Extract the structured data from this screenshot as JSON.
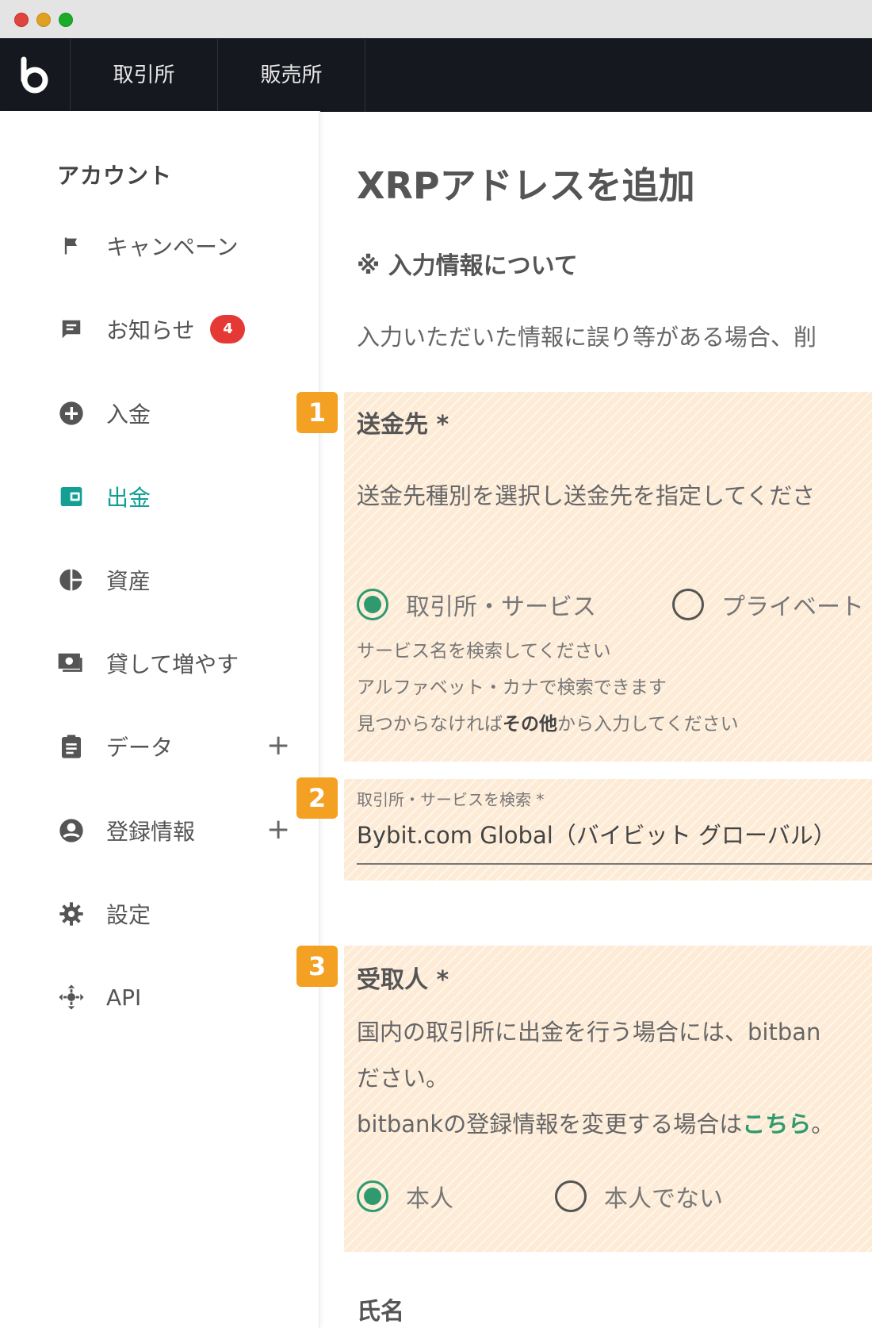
{
  "nav": {
    "tabs": [
      {
        "label": "取引所"
      },
      {
        "label": "販売所"
      }
    ]
  },
  "sidebar": {
    "title": "アカウント",
    "items": [
      {
        "label": "キャンペーン",
        "icon": "flag-icon"
      },
      {
        "label": "お知らせ",
        "icon": "chat-icon",
        "badge": "4"
      },
      {
        "label": "入金",
        "icon": "plus-circle-icon"
      },
      {
        "label": "出金",
        "icon": "wallet-icon",
        "active": true
      },
      {
        "label": "資産",
        "icon": "pie-chart-icon"
      },
      {
        "label": "貸して増やす",
        "icon": "money-icon"
      },
      {
        "label": "データ",
        "icon": "clipboard-icon",
        "expand": "+"
      },
      {
        "label": "登録情報",
        "icon": "account-circle-icon",
        "expand": "+"
      },
      {
        "label": "設定",
        "icon": "gear-icon"
      },
      {
        "label": "API",
        "icon": "api-icon"
      }
    ],
    "active_color": "#12a094",
    "badge_color": "#e53935"
  },
  "main": {
    "title": "XRPアドレスを追加",
    "notice_heading": "※ 入力情報について",
    "notice_text": "入力いただいた情報に誤り等がある場合、削",
    "destination": {
      "label": "送金先 *",
      "description": "送金先種別を選択し送金先を指定してくださ",
      "options": [
        "取引所・サービス",
        "プライベート"
      ],
      "selected": "取引所・サービス",
      "hints": {
        "line1": "サービス名を検索してください",
        "line2": "アルファベット・カナで検索できます",
        "line3_prefix": "見つからなければ",
        "line3_bold": "その他",
        "line3_suffix": "から入力してください"
      }
    },
    "search": {
      "label": "取引所・サービスを検索 *",
      "value": "Bybit.com Global（バイビット グローバル）"
    },
    "recipient": {
      "label": "受取人 *",
      "desc_line1": "国内の取引所に出金を行う場合には、bitban",
      "desc_line2": "ださい。",
      "desc_line3_prefix": "bitbankの登録情報を変更する場合は",
      "desc_line3_link": "こちら",
      "desc_line3_suffix": "。",
      "options": [
        "本人",
        "本人でない"
      ],
      "selected": "本人"
    },
    "name_label": "氏名"
  },
  "markers": [
    "1",
    "2",
    "3"
  ],
  "colors": {
    "highlight": "#fdebd6",
    "marker": "#f4a023",
    "radio_selected": "#2f9a6e",
    "nav_bg": "#15181f"
  }
}
